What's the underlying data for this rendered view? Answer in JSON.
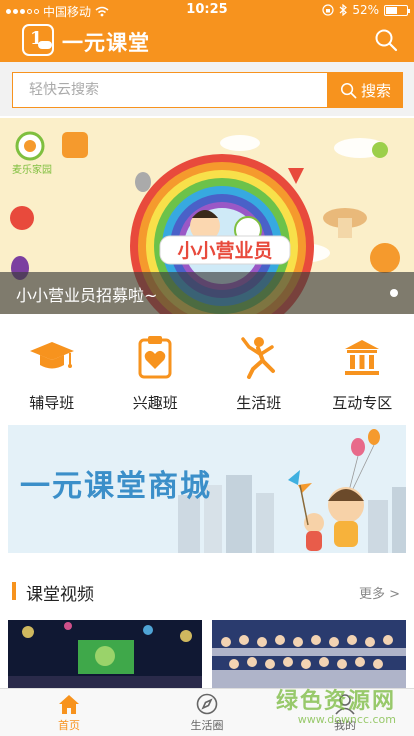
{
  "status_bar": {
    "carrier": "中国移动",
    "time": "10:25",
    "battery": "52%"
  },
  "header": {
    "app_title": "一元课堂",
    "logo_text": "1元课堂"
  },
  "search": {
    "placeholder": "轻快云搜索",
    "button_label": "搜索"
  },
  "banner": {
    "caption": "小小营业员招募啦~",
    "brand_text": "麦乐家园",
    "art_title": "小小营业员"
  },
  "categories": [
    {
      "label": "辅导班",
      "icon": "graduation-cap-icon"
    },
    {
      "label": "兴趣班",
      "icon": "heart-clipboard-icon"
    },
    {
      "label": "生活班",
      "icon": "runner-icon"
    },
    {
      "label": "互动专区",
      "icon": "museum-icon"
    }
  ],
  "mall_banner": {
    "text": "一元课堂商城"
  },
  "section": {
    "title": "课堂视频",
    "more": "更多 >"
  },
  "tabbar": [
    {
      "label": "首页",
      "icon": "home-icon",
      "active": true
    },
    {
      "label": "生活圈",
      "icon": "compass-icon",
      "active": false
    },
    {
      "label": "我的",
      "icon": "user-icon",
      "active": false
    }
  ],
  "watermark": {
    "line1": "绿色资源网",
    "line2": "www.downcc.com"
  },
  "colors": {
    "accent": "#f7931e",
    "tab_active": "#f7931e",
    "mall_text": "#3b8fc9"
  }
}
